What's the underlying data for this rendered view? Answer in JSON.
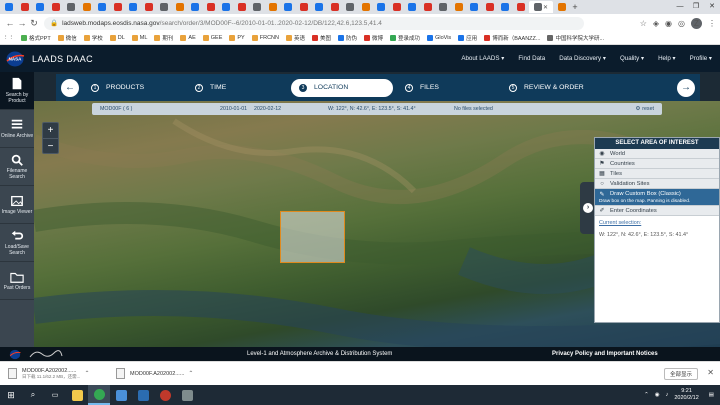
{
  "browser": {
    "tab_count": 36,
    "active_tab_index": 34,
    "url_main": "ladsweb.modaps.eosdis.nasa.gov",
    "url_rest": "/search/order/3/MOD00F--6/2010-01-01..2020-02-12/DB/122,42.6,123.5,41.4",
    "avatar_letter": "Z",
    "bookmarks": [
      {
        "label": "格式PPT",
        "color": "#4caf50"
      },
      {
        "label": "微信",
        "color": "#e9a23b"
      },
      {
        "label": "学校",
        "color": "#e9a23b"
      },
      {
        "label": "DL",
        "color": "#e9a23b"
      },
      {
        "label": "ML",
        "color": "#e9a23b"
      },
      {
        "label": "期刊",
        "color": "#e9a23b"
      },
      {
        "label": "AE",
        "color": "#e9a23b"
      },
      {
        "label": "GEE",
        "color": "#e9a23b"
      },
      {
        "label": "PY",
        "color": "#e9a23b"
      },
      {
        "label": "FRCNN",
        "color": "#e9a23b"
      },
      {
        "label": "英语",
        "color": "#e9a23b"
      },
      {
        "label": "美图",
        "color": "#d93025"
      },
      {
        "label": "防伪",
        "color": "#1a73e8"
      },
      {
        "label": "微博",
        "color": "#d93025"
      },
      {
        "label": "登录成功",
        "color": "#34a853"
      },
      {
        "label": "GloVis",
        "color": "#1a73e8"
      },
      {
        "label": "应用",
        "color": "#1a73e8"
      },
      {
        "label": "博而新（BAANZZ...",
        "color": "#d93025"
      },
      {
        "label": "中国科学院大学研...",
        "color": "#666666"
      }
    ]
  },
  "site": {
    "title": "LAADS DAAC",
    "nav": [
      "About LAADS ▾",
      "Find Data",
      "Data Discovery ▾",
      "Quality ▾",
      "Help ▾",
      "Profile ▾"
    ]
  },
  "rail": [
    {
      "label": "Search by Product",
      "icon": "document-icon"
    },
    {
      "label": "Online Archive",
      "icon": "list-icon"
    },
    {
      "label": "Filename Search",
      "icon": "search-icon"
    },
    {
      "label": "Image Viewer",
      "icon": "image-icon"
    },
    {
      "label": "Load/Save Search",
      "icon": "undo-icon"
    },
    {
      "label": "Past Orders",
      "icon": "folder-icon"
    }
  ],
  "wizard": {
    "steps": [
      {
        "num": "1",
        "label": "PRODUCTS"
      },
      {
        "num": "2",
        "label": "TIME"
      },
      {
        "num": "3",
        "label": "LOCATION"
      },
      {
        "num": "4",
        "label": "FILES"
      },
      {
        "num": "5",
        "label": "REVIEW & ORDER"
      }
    ],
    "active": 2
  },
  "summary": {
    "product": "MOD00F ( 6 )",
    "start": "2010-01-01",
    "end": "2020-02-12",
    "bbox": "W: 122°, N: 42.6°, E: 123.5°, S: 41.4°",
    "files": "No files selected",
    "reset": "reset"
  },
  "zoom": {
    "in": "+",
    "out": "−"
  },
  "panel": {
    "title": "SELECT AREA OF INTEREST",
    "options": [
      {
        "label": "World",
        "icon": "globe-icon"
      },
      {
        "label": "Countries",
        "icon": "flag-icon"
      },
      {
        "label": "Tiles",
        "icon": "grid-icon"
      },
      {
        "label": "Validation Sites",
        "icon": "target-icon"
      },
      {
        "label": "Draw Custom Box (Classic)",
        "sub": "Draw box on the map. Panning is disabled.",
        "icon": "edit-icon"
      },
      {
        "label": "Enter Coordinates",
        "icon": "pencil-icon"
      }
    ],
    "current_label": "Current selection:",
    "current_value": "W: 122°, N: 42.6°, E: 123.5°, S: 41.4°"
  },
  "footer": {
    "middle": "Level-1 and Atmosphere Archive & Distribution System",
    "right": "Privacy Policy and Important Notices"
  },
  "downloads": {
    "items": [
      {
        "name": "MOD00F.A202002......",
        "sub": "日下载 11.1/62.2 MB，还需..."
      },
      {
        "name": "MOD00F.A202002......",
        "sub": ""
      }
    ],
    "show_all": "全部显示"
  },
  "taskbar": {
    "time": "9:21",
    "date": "2020/2/12"
  }
}
